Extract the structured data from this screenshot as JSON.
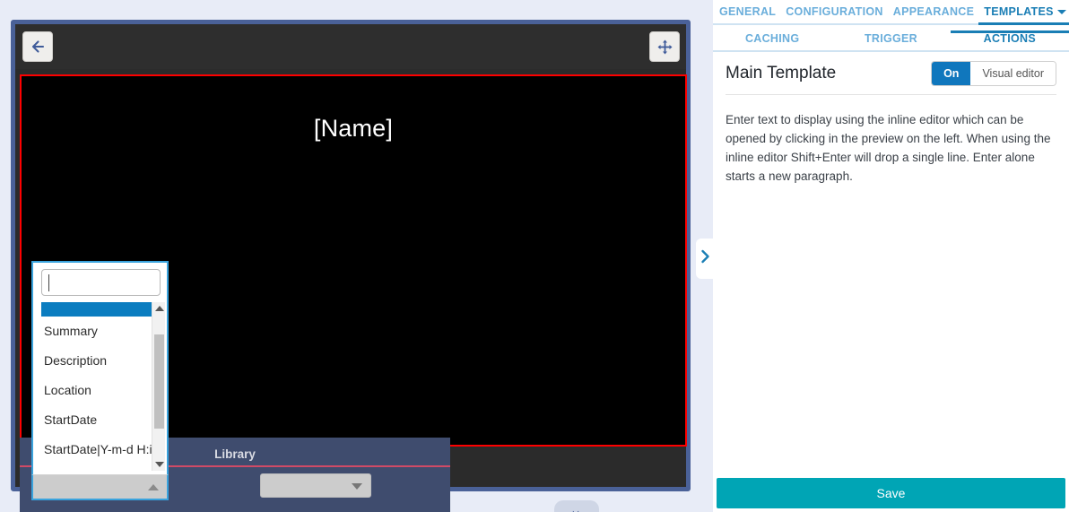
{
  "preview": {
    "back_icon": "arrow-left-icon",
    "move_icon": "move-arrows-icon",
    "canvas_text": "[Name]",
    "library": {
      "title": "Library",
      "select_value": "",
      "caret_icon": "chevron-down-icon"
    },
    "combobox": {
      "search_value": "",
      "selected_value": "",
      "caret_icon": "chevron-up-icon",
      "scroll_up_icon": "triangle-up-icon",
      "scroll_down_icon": "triangle-down-icon",
      "items": [
        "",
        "Summary",
        "Description",
        "Location",
        "StartDate",
        "StartDate|Y-m-d H:i"
      ]
    },
    "bottom_handle_dots": "··"
  },
  "pane_toggle": {
    "icon": "chevron-right-icon"
  },
  "settings": {
    "tabs_primary": [
      {
        "label": "GENERAL",
        "active": false
      },
      {
        "label": "CONFIGURATION",
        "active": false
      },
      {
        "label": "APPEARANCE",
        "active": false
      },
      {
        "label": "TEMPLATES",
        "active": true
      }
    ],
    "tabs_secondary": [
      {
        "label": "CACHING",
        "active": false
      },
      {
        "label": "TRIGGER",
        "active": false
      },
      {
        "label": "ACTIONS",
        "active": true
      }
    ],
    "section_title": "Main Template",
    "toggle": {
      "on_label": "On",
      "visual_label": "Visual editor"
    },
    "help_text": "Enter text to display using the inline editor which can be opened by clicking in the preview on the left. When using the inline editor Shift+Enter will drop a single line. Enter alone starts a new paragraph.",
    "save_label": "Save"
  },
  "colors": {
    "accent_blue": "#1a7eb5",
    "toggle_on": "#1077bd",
    "save_teal": "#00a5b5",
    "canvas_border_red": "#fe0000",
    "frame_blue": "#4a6198",
    "library_bg": "#3f4c6e"
  }
}
